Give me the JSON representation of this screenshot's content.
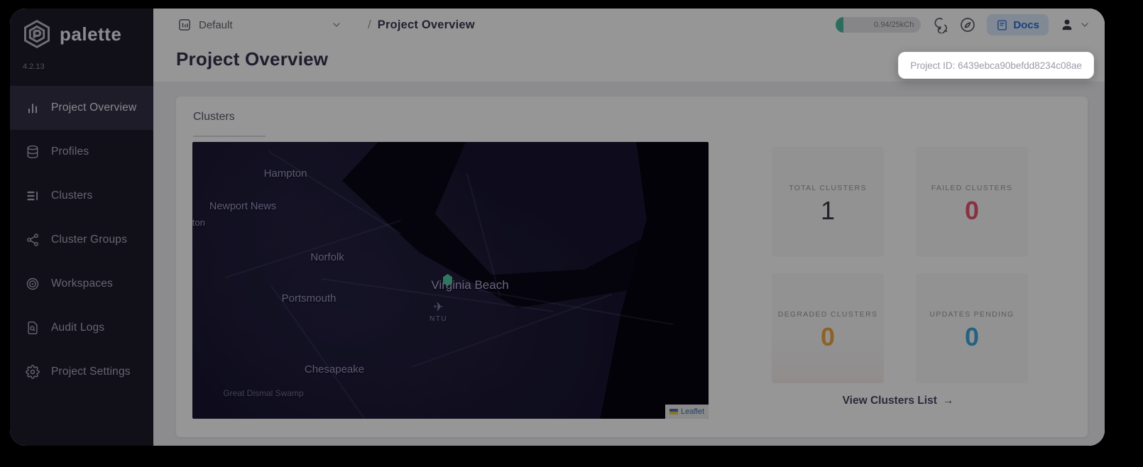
{
  "app": {
    "name": "palette",
    "version": "4.2.13"
  },
  "sidebar": {
    "items": [
      {
        "label": "Project Overview",
        "active": true
      },
      {
        "label": "Profiles",
        "active": false
      },
      {
        "label": "Clusters",
        "active": false
      },
      {
        "label": "Cluster Groups",
        "active": false
      },
      {
        "label": "Workspaces",
        "active": false
      },
      {
        "label": "Audit Logs",
        "active": false
      },
      {
        "label": "Project Settings",
        "active": false
      }
    ]
  },
  "topbar": {
    "project_selector": {
      "value": "Default"
    },
    "breadcrumb": {
      "separator": "/",
      "current": "Project Overview"
    },
    "usage_badge": "0.94/25kCh",
    "docs_label": "Docs"
  },
  "tooltip": {
    "text": "Project ID: 6439ebca90befdd8234c08ae"
  },
  "page": {
    "title": "Project Overview"
  },
  "clusters_card": {
    "heading": "Clusters",
    "view_link": "View Clusters List",
    "arrow": "→"
  },
  "map": {
    "labels": [
      "Hampton",
      "Newport News",
      "llton",
      "Norfolk",
      "Virginia Beach",
      "Portsmouth",
      "Chesapeake",
      "Great Dismal Swamp"
    ],
    "airport_code": "NTU",
    "plane_glyph": "✈",
    "attribution": "Leaflet",
    "marker_color": "#54CBA4"
  },
  "stats": [
    {
      "label": "TOTAL CLUSTERS",
      "value": "1",
      "color": "#3B3945"
    },
    {
      "label": "FAILED CLUSTERS",
      "value": "0",
      "color": "#E8556F"
    },
    {
      "label": "DEGRADED CLUSTERS",
      "value": "0",
      "color": "#F0A740"
    },
    {
      "label": "UPDATES PENDING",
      "value": "0",
      "color": "#3FA7DC"
    }
  ],
  "colors": {
    "docs_blue": "#2B6FD4",
    "usage_teal": "#49B8A2",
    "sidebar_bg": "#1E1A29"
  }
}
